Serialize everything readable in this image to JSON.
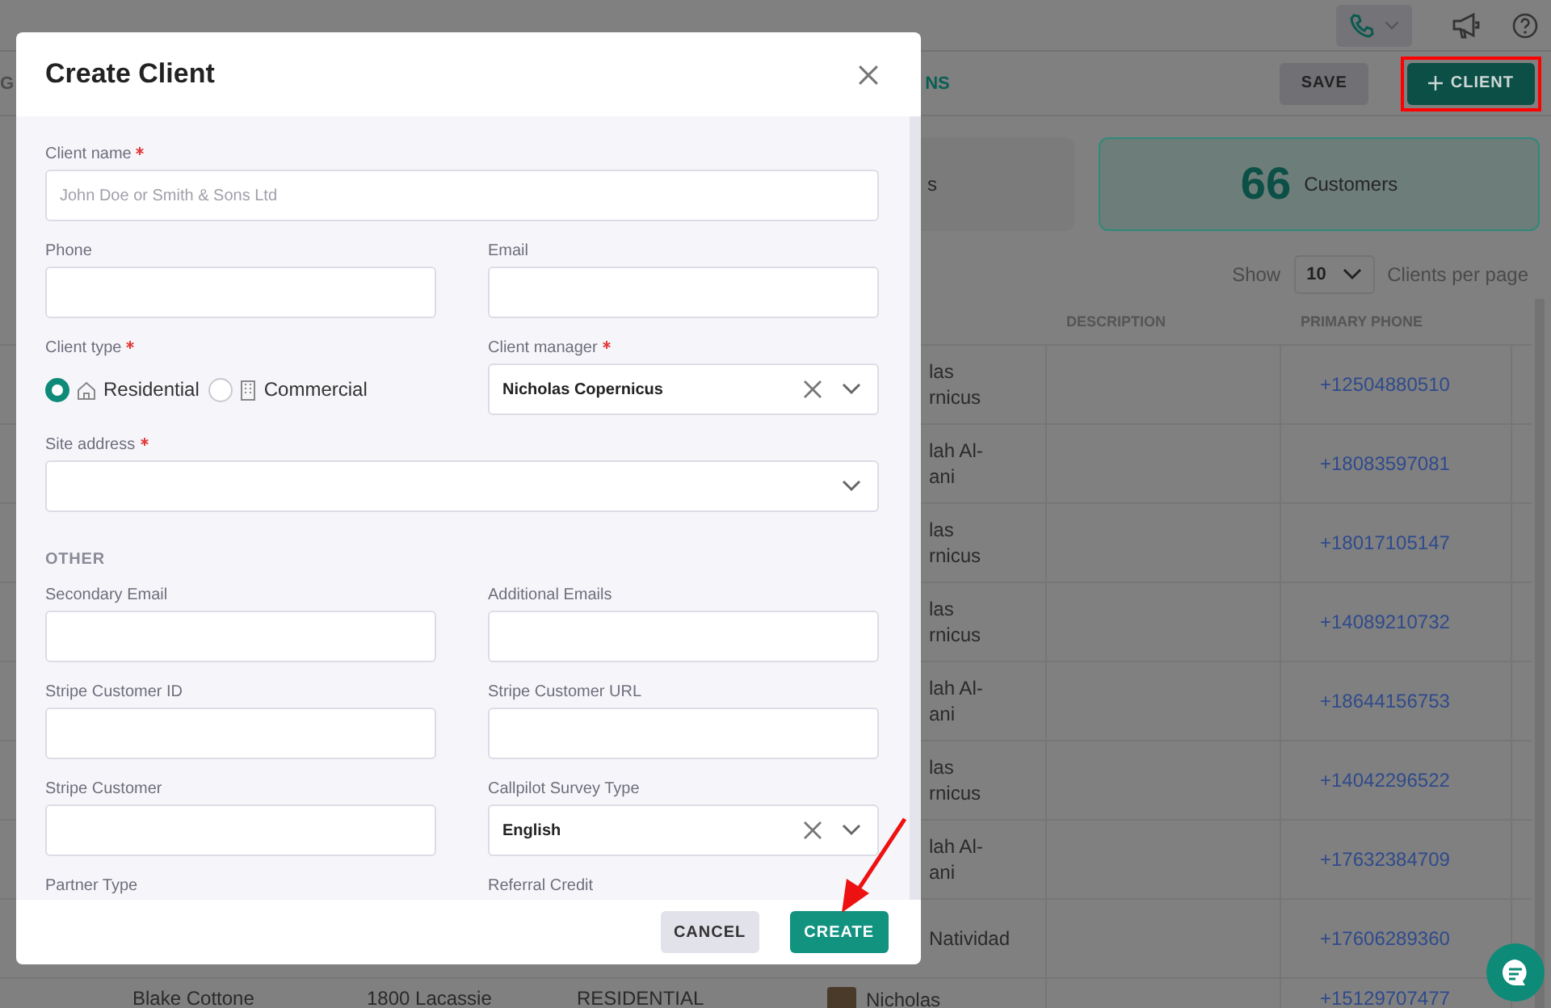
{
  "top_bar": {
    "phone_menu": {
      "expanded": false
    }
  },
  "toolbar": {
    "tab_fragments": [
      "G",
      "NS"
    ],
    "buttons": [
      {
        "label": "SAVE",
        "kind": "secondary",
        "highlighted": false
      },
      {
        "label": "CLIENT",
        "kind": "primary",
        "highlighted": true
      }
    ]
  },
  "stat_cards": [
    {
      "label": "s",
      "selected": false
    },
    {
      "value": "66",
      "label": "Customers",
      "selected": true
    }
  ],
  "pagination": {
    "prefix": "Show",
    "page_size": "10",
    "suffix": "Clients per page"
  },
  "table": {
    "columns": [
      "DESCRIPTION",
      "PRIMARY PHONE"
    ],
    "rows": [
      {
        "manager": "las\nrnicus",
        "phone": "+12504880510"
      },
      {
        "manager": "lah Al-\nani",
        "phone": "+18083597081"
      },
      {
        "manager": "las\nrnicus",
        "phone": "+18017105147"
      },
      {
        "manager": "las\nrnicus",
        "phone": "+14089210732"
      },
      {
        "manager": "lah Al-\nani",
        "phone": "+18644156753"
      },
      {
        "manager": "las\nrnicus",
        "phone": "+14042296522"
      },
      {
        "manager": "lah Al-\nani",
        "phone": "+17632384709"
      },
      {
        "manager": "Natividad",
        "phone": "+17606289360"
      },
      {
        "name": "Blake Cottone",
        "address": "1800 Lacassie",
        "client_type": "RESIDENTIAL",
        "manager": "Nicholas",
        "phone": "+15129707477"
      }
    ]
  },
  "dialog": {
    "title": "Create Client",
    "form_rows": [
      {
        "fields": [
          {
            "kind": "text",
            "label": "Client name",
            "required": true,
            "placeholder": "John Doe or Smith & Sons Ltd"
          }
        ]
      },
      {
        "fields": [
          {
            "kind": "text",
            "label": "Phone",
            "required": false
          },
          {
            "kind": "text",
            "label": "Email",
            "required": false
          }
        ]
      },
      {
        "fields": [
          {
            "kind": "radio",
            "label": "Client type",
            "required": true,
            "options": [
              {
                "label": "Residential",
                "selected": true
              },
              {
                "label": "Commercial",
                "selected": false
              }
            ]
          },
          {
            "kind": "select",
            "label": "Client manager",
            "required": true,
            "value": "Nicholas Copernicus",
            "clearable": true
          }
        ]
      },
      {
        "fields": [
          {
            "kind": "select",
            "label": "Site address",
            "required": true,
            "clearable": false
          }
        ]
      },
      {
        "heading": "OTHER"
      },
      {
        "fields": [
          {
            "kind": "text",
            "label": "Secondary Email",
            "required": false
          },
          {
            "kind": "text",
            "label": "Additional Emails",
            "required": false
          }
        ]
      },
      {
        "fields": [
          {
            "kind": "text",
            "label": "Stripe Customer ID",
            "required": false
          },
          {
            "kind": "text",
            "label": "Stripe Customer URL",
            "required": false
          }
        ]
      },
      {
        "fields": [
          {
            "kind": "text",
            "label": "Stripe Customer",
            "required": false
          },
          {
            "kind": "select",
            "label": "Callpilot Survey Type",
            "required": false,
            "value": "English",
            "clearable": true
          }
        ]
      },
      {
        "fields": [
          {
            "kind": "label",
            "label": "Partner Type",
            "required": false
          },
          {
            "kind": "label",
            "label": "Referral Credit",
            "required": false
          }
        ]
      }
    ],
    "buttons": [
      {
        "label": "CANCEL",
        "kind": "secondary",
        "pointed": false
      },
      {
        "label": "CREATE",
        "kind": "primary",
        "pointed": true
      }
    ]
  }
}
